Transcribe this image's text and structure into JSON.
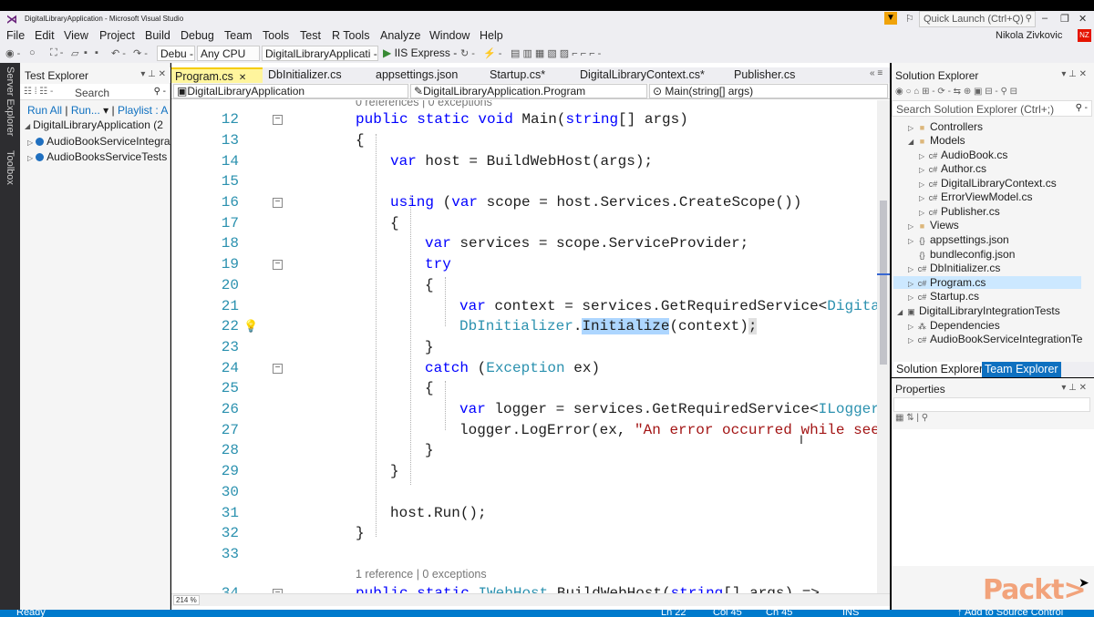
{
  "window": {
    "title": "DigitalLibraryApplication - Microsoft Visual Studio",
    "quick_launch_placeholder": "Quick Launch (Ctrl+Q)",
    "user": "Nikola Zivkovic",
    "user_initials": "NZ",
    "minimize": "–",
    "restore": "❐",
    "close": "✕"
  },
  "menu": [
    "File",
    "Edit",
    "View",
    "Project",
    "Build",
    "Debug",
    "Team",
    "Tools",
    "Test",
    "R Tools",
    "Analyze",
    "Window",
    "Help"
  ],
  "toolbar": {
    "config": "Debu -",
    "platform": "Any CPU",
    "startup_project": "DigitalLibraryApplicati -",
    "run_target": "IIS Express -"
  },
  "side_strip": {
    "server_explorer": "Server Explorer",
    "toolbox": "Toolbox"
  },
  "test_explorer": {
    "title": "Test Explorer",
    "search_placeholder": "Search",
    "run_all": "Run All",
    "run": "Run...",
    "playlist": "Playlist : A",
    "items": [
      "DigitalLibraryApplication (2",
      "AudioBookServiceIntegra",
      "AudioBooksServiceTests"
    ]
  },
  "editor": {
    "tabs": [
      "Program.cs",
      "DbInitializer.cs",
      "appsettings.json",
      "Startup.cs*",
      "DigitalLibraryContext.cs*",
      "Publisher.cs"
    ],
    "nav_project": "DigitalLibraryApplication",
    "nav_class": "DigitalLibraryApplication.Program",
    "nav_member": "Main(string[] args)",
    "codelens_top": "0 references | 0 exceptions",
    "codelens_bottom": "1 reference | 0 exceptions",
    "zoom": "214 %",
    "lines": [
      {
        "n": "12",
        "text": "public static void Main(string[] args)"
      },
      {
        "n": "13",
        "text": "{"
      },
      {
        "n": "14",
        "text": "var host = BuildWebHost(args);"
      },
      {
        "n": "15",
        "text": ""
      },
      {
        "n": "16",
        "text": "using (var scope = host.Services.CreateScope())"
      },
      {
        "n": "17",
        "text": "{"
      },
      {
        "n": "18",
        "text": "var services = scope.ServiceProvider;"
      },
      {
        "n": "19",
        "text": "try"
      },
      {
        "n": "20",
        "text": "{"
      },
      {
        "n": "21",
        "text": "var context = services.GetRequiredService<Digita"
      },
      {
        "n": "22",
        "text": "DbInitializer.Initialize(context);"
      },
      {
        "n": "23",
        "text": "}"
      },
      {
        "n": "24",
        "text": "catch (Exception ex)"
      },
      {
        "n": "25",
        "text": "{"
      },
      {
        "n": "26",
        "text": "var logger = services.GetRequiredService<ILogger"
      },
      {
        "n": "27",
        "text": "logger.LogError(ex, \"An error occurred while see"
      },
      {
        "n": "28",
        "text": "}"
      },
      {
        "n": "29",
        "text": "}"
      },
      {
        "n": "30",
        "text": ""
      },
      {
        "n": "31",
        "text": "host.Run();"
      },
      {
        "n": "32",
        "text": "}"
      },
      {
        "n": "33",
        "text": ""
      },
      {
        "n": "34",
        "text": "public static IWebHost BuildWebHost(string[] args) =>"
      }
    ]
  },
  "solution_explorer": {
    "title": "Solution Explorer",
    "search_placeholder": "Search Solution Explorer (Ctrl+;)",
    "items": [
      {
        "label": "Controllers",
        "kind": "folder"
      },
      {
        "label": "Models",
        "kind": "folder"
      },
      {
        "label": "AudioBook.cs",
        "kind": "cs"
      },
      {
        "label": "Author.cs",
        "kind": "cs"
      },
      {
        "label": "DigitalLibraryContext.cs",
        "kind": "cs"
      },
      {
        "label": "ErrorViewModel.cs",
        "kind": "cs"
      },
      {
        "label": "Publisher.cs",
        "kind": "cs"
      },
      {
        "label": "Views",
        "kind": "folder"
      },
      {
        "label": "appsettings.json",
        "kind": "json"
      },
      {
        "label": "bundleconfig.json",
        "kind": "json"
      },
      {
        "label": "DbInitializer.cs",
        "kind": "cs"
      },
      {
        "label": "Program.cs",
        "kind": "cs"
      },
      {
        "label": "Startup.cs",
        "kind": "cs"
      },
      {
        "label": "DigitalLibraryIntegrationTests",
        "kind": "project"
      },
      {
        "label": "Dependencies",
        "kind": "deps"
      },
      {
        "label": "AudioBookServiceIntegrationTe",
        "kind": "cs"
      }
    ],
    "tab_active": "Solution Explorer",
    "tab_other": "Team Explorer"
  },
  "properties": {
    "title": "Properties"
  },
  "watermark": "Packt>",
  "status": {
    "ready": "Ready",
    "ln": "Ln 22",
    "col": "Col 45",
    "ch": "Ch 45",
    "ins": "INS",
    "source_control": "↑ Add to Source Control"
  },
  "colors": {
    "keyword": "#0000ff",
    "type": "#2b91af",
    "string": "#a31515",
    "status_bar": "#007acc",
    "active_tab": "#fff59d"
  }
}
